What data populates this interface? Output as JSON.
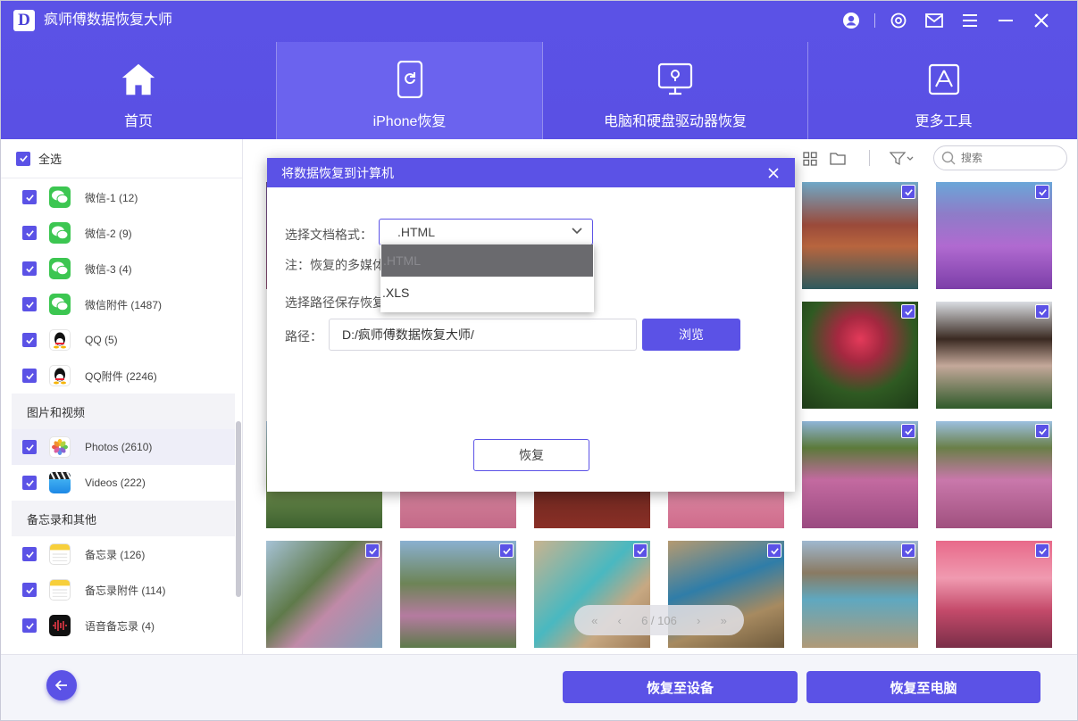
{
  "app": {
    "logo_letter": "D",
    "title": "疯师傅数据恢复大师"
  },
  "window_controls": [
    "account-icon",
    "settings-icon",
    "mail-icon",
    "menu-icon",
    "minimize-icon",
    "close-icon"
  ],
  "nav": {
    "home": "首页",
    "iphone": "iPhone恢复",
    "pc": "电脑和硬盘驱动器恢复",
    "tools": "更多工具"
  },
  "sidebar": {
    "select_all": "全选",
    "items": [
      {
        "label": "微信-1 (12)",
        "icon": "wechat-icon"
      },
      {
        "label": "微信-2 (9)",
        "icon": "wechat-icon"
      },
      {
        "label": "微信-3 (4)",
        "icon": "wechat-icon"
      },
      {
        "label": "微信附件 (1487)",
        "icon": "wechat-icon"
      },
      {
        "label": "QQ (5)",
        "icon": "qq-icon"
      },
      {
        "label": "QQ附件 (2246)",
        "icon": "qq-icon"
      }
    ],
    "group_media": "图片和视频",
    "media_items": [
      {
        "label": "Photos (2610)",
        "icon": "photos-icon"
      },
      {
        "label": "Videos (222)",
        "icon": "videos-icon"
      }
    ],
    "group_other": "备忘录和其他",
    "other_items": [
      {
        "label": "备忘录 (126)",
        "icon": "notes-icon"
      },
      {
        "label": "备忘录附件 (114)",
        "icon": "notes-icon"
      },
      {
        "label": "语音备忘录 (4)",
        "icon": "voice-memo-icon"
      }
    ]
  },
  "toolbar": {
    "search_placeholder": "搜索"
  },
  "pager": {
    "text": "6 / 106"
  },
  "bottom": {
    "to_device": "恢复至设备",
    "to_pc": "恢复至电脑"
  },
  "modal": {
    "title": "将数据恢复到计算机",
    "format_label": "选择文档格式：",
    "format_value": ".HTML",
    "note": "注：恢复的多媒体",
    "path_section": "选择路径保存恢复",
    "path_label": "路径：",
    "path_value": "D:/疯师傅数据恢复大师/",
    "browse": "浏览",
    "recover": "恢复",
    "options": [
      ".HTML",
      ".XLS"
    ]
  },
  "colors": {
    "accent": "#5b52e6",
    "accent_light": "#6b63ee"
  }
}
